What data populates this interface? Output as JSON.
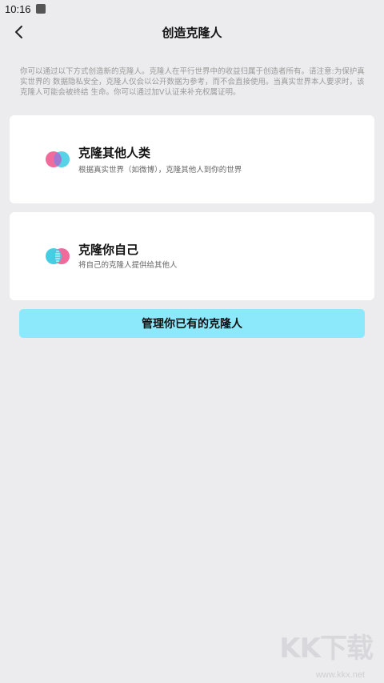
{
  "status_bar": {
    "time": "10:16"
  },
  "header": {
    "title": "创造克隆人"
  },
  "notice": "你可以通过以下方式创造新的克隆人。克隆人在平行世界中的收益归属于创造者所有。请注意:为保护真实世界的 数据隐私安全，克隆人仅会以公开数据为参考，而不会直接使用。当真实世界本人要求时，该克隆人可能会被终结 生命。你可以通过加V认证来补充权属证明。",
  "cards": [
    {
      "title": "克隆其他人类",
      "description": "根据真实世界（如微博），克隆其他人到你的世界",
      "icon": "overlapping-circles-icon"
    },
    {
      "title": "克隆你自己",
      "description": "将自己的克隆人提供给其他人",
      "icon": "merged-circles-icon"
    }
  ],
  "manage_button": "管理你已有的克隆人",
  "watermark": {
    "text": "KK下载",
    "url": "www.kkx.net"
  },
  "colors": {
    "pink": "#f06a9b",
    "cyan": "#45cde3",
    "button": "#8ce9fb",
    "background": "#ececee"
  }
}
